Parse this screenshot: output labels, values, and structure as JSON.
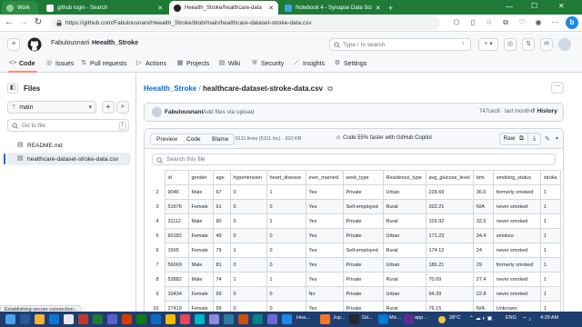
{
  "browser": {
    "tabs": [
      {
        "label": "Work",
        "kind": "profile"
      },
      {
        "label": "github login - Search",
        "kind": "search"
      },
      {
        "label": "Heealth_Stroke/healthcare-data",
        "kind": "github",
        "active": true
      },
      {
        "label": "Notebook 4 - Synapse Data Sci",
        "kind": "synapse"
      }
    ],
    "new_tab_label": "+",
    "url": "https://github.com/Fabulousnani/Heealth_Stroke/blob/main/healthcare-dataset-stroke-data.csv",
    "status_text": "Establishing secure connection..."
  },
  "github": {
    "owner": "Fabulousnani",
    "separator": "/",
    "repo": "Heealth_Stroke",
    "search_placeholder": "Type / to search",
    "search_slash": "/",
    "nav_tabs": [
      "Code",
      "Issues",
      "Pull requests",
      "Actions",
      "Projects",
      "Wiki",
      "Security",
      "Insights",
      "Settings"
    ],
    "active_tab": "Code"
  },
  "sidebar": {
    "title": "Files",
    "branch": "main",
    "goto_placeholder": "Go to file",
    "goto_shortcut": "t",
    "files": [
      {
        "name": "README.md",
        "selected": false
      },
      {
        "name": "healthcare-dataset-stroke-data.csv",
        "selected": true
      }
    ]
  },
  "file": {
    "repo": "Heealth_Stroke",
    "separator": "/",
    "name": "healthcare-dataset-stroke-data.csv",
    "author": "Fabulousnani",
    "commit_message": "Add files via upload",
    "commit_meta": "747cec8 · last month",
    "history_label": "History",
    "view_tabs": [
      "Preview",
      "Code",
      "Blame"
    ],
    "active_view": "Preview",
    "stats": "5111 lines (5111 loc) · 310 KB",
    "copilot_text": "Code 55% faster with GitHub Copilot",
    "raw_label": "Raw",
    "search_placeholder": "Search this file"
  },
  "table": {
    "columns": [
      "id",
      "gender",
      "age",
      "hypertension",
      "heart_disease",
      "ever_married",
      "work_type",
      "Residence_type",
      "avg_glucose_level",
      "bmi",
      "smoking_status",
      "stroke"
    ],
    "rows": [
      {
        "n": "2",
        "cells": [
          "9046",
          "Male",
          "67",
          "0",
          "1",
          "Yes",
          "Private",
          "Urban",
          "228.69",
          "36.6",
          "formerly smoked",
          "1"
        ]
      },
      {
        "n": "3",
        "cells": [
          "51676",
          "Female",
          "61",
          "0",
          "0",
          "Yes",
          "Self-employed",
          "Rural",
          "202.21",
          "N/A",
          "never smoked",
          "1"
        ]
      },
      {
        "n": "4",
        "cells": [
          "31112",
          "Male",
          "80",
          "0",
          "1",
          "Yes",
          "Private",
          "Rural",
          "105.92",
          "32.5",
          "never smoked",
          "1"
        ]
      },
      {
        "n": "5",
        "cells": [
          "60182",
          "Female",
          "49",
          "0",
          "0",
          "Yes",
          "Private",
          "Urban",
          "171.23",
          "34.4",
          "smokes",
          "1"
        ]
      },
      {
        "n": "6",
        "cells": [
          "1665",
          "Female",
          "79",
          "1",
          "0",
          "Yes",
          "Self-employed",
          "Rural",
          "174.12",
          "24",
          "never smoked",
          "1"
        ]
      },
      {
        "n": "7",
        "cells": [
          "56669",
          "Male",
          "81",
          "0",
          "0",
          "Yes",
          "Private",
          "Urban",
          "186.21",
          "29",
          "formerly smoked",
          "1"
        ]
      },
      {
        "n": "8",
        "cells": [
          "53882",
          "Male",
          "74",
          "1",
          "1",
          "Yes",
          "Private",
          "Rural",
          "70.09",
          "27.4",
          "never smoked",
          "1"
        ]
      },
      {
        "n": "9",
        "cells": [
          "10434",
          "Female",
          "69",
          "0",
          "0",
          "No",
          "Private",
          "Urban",
          "94.39",
          "22.8",
          "never smoked",
          "1"
        ]
      },
      {
        "n": "10",
        "cells": [
          "27419",
          "Female",
          "59",
          "0",
          "0",
          "Yes",
          "Private",
          "Rural",
          "76.15",
          "N/A",
          "Unknown",
          "1"
        ]
      }
    ]
  },
  "taskbar": {
    "labels": [
      "Hea...",
      "Jup...",
      "Git...",
      "Mic...",
      "app..."
    ],
    "weather": "28°C",
    "language": "ENG",
    "time": "4:29 AM"
  },
  "colors": {
    "tab_strip": "#1e7a35",
    "link": "#0969da",
    "taskbar": "#1f3e70",
    "nav_underline": "#fd8c73"
  }
}
